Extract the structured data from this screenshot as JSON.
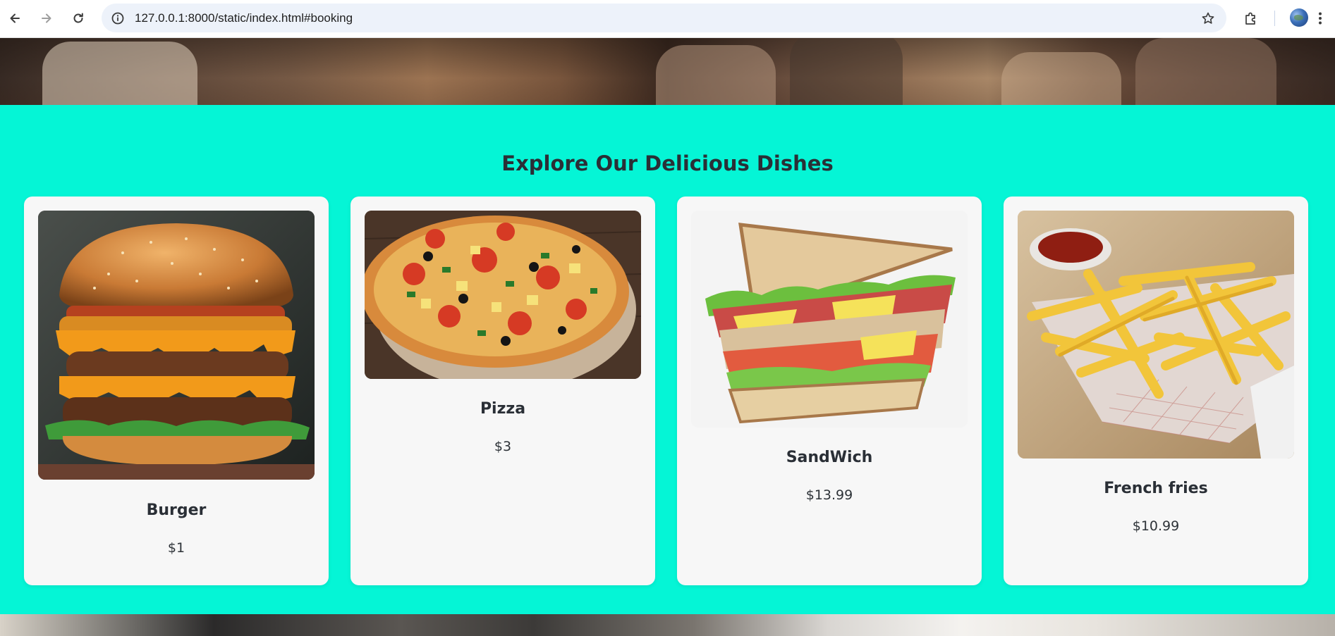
{
  "browser": {
    "url": "127.0.0.1:8000/static/index.html#booking",
    "back_icon": "arrow-left-icon",
    "forward_icon": "arrow-right-icon",
    "reload_icon": "reload-icon",
    "site_info_icon": "info-icon",
    "bookmark_icon": "star-icon",
    "extensions_icon": "puzzle-icon",
    "menu_icon": "kebab-menu-icon"
  },
  "section": {
    "title": "Explore Our Delicious Dishes",
    "background_color": "#05f5d6"
  },
  "dishes": [
    {
      "name": "Burger",
      "price": "$1",
      "image": "burger-image"
    },
    {
      "name": "Pizza",
      "price": "$3",
      "image": "pizza-image"
    },
    {
      "name": "SandWich",
      "price": "$13.99",
      "image": "sandwich-image"
    },
    {
      "name": "French fries",
      "price": "$10.99",
      "image": "french-fries-image"
    }
  ]
}
